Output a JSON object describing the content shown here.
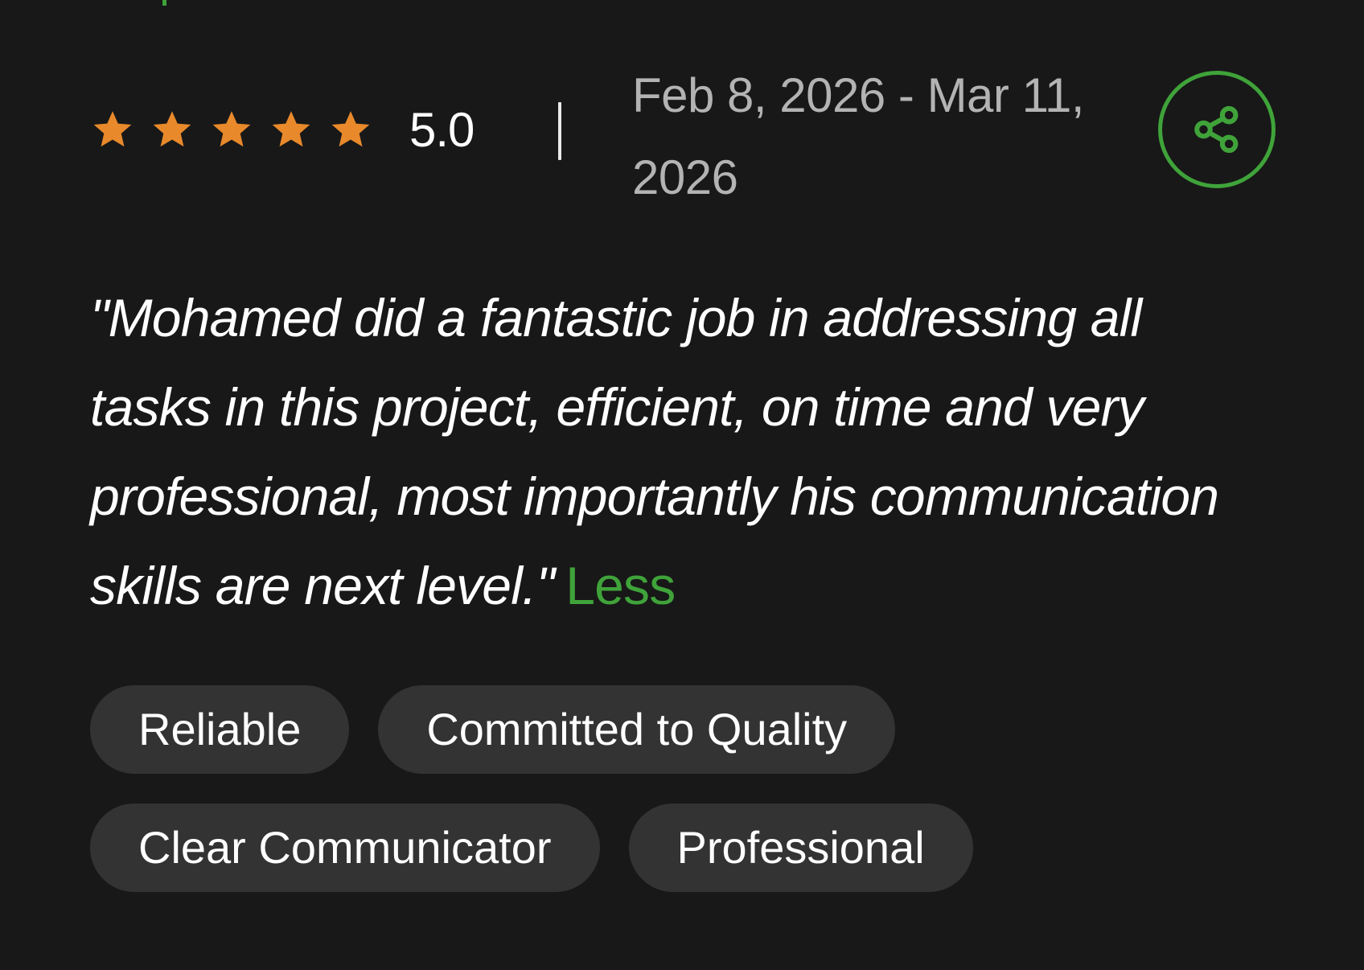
{
  "review": {
    "rating": 5.0,
    "rating_max": 5,
    "rating_label": "5.0",
    "date_range": "Feb 8, 2026 - Mar 11, 2026",
    "quote": "\"Mohamed did a fantastic job in addressing all tasks in this project, efficient, on time and very professional, most importantly his communication skills are next level.\"",
    "less_label": "Less",
    "tags": [
      "Reliable",
      "Committed to Quality",
      "Clear Communicator",
      "Professional"
    ]
  },
  "icons": {
    "star": "star-icon",
    "share": "share-icon"
  },
  "colors": {
    "background": "#181818",
    "star": "#e8892b",
    "accent_green": "#3fa33a",
    "date_text": "#b3b3b3",
    "tag_background": "#333333"
  }
}
